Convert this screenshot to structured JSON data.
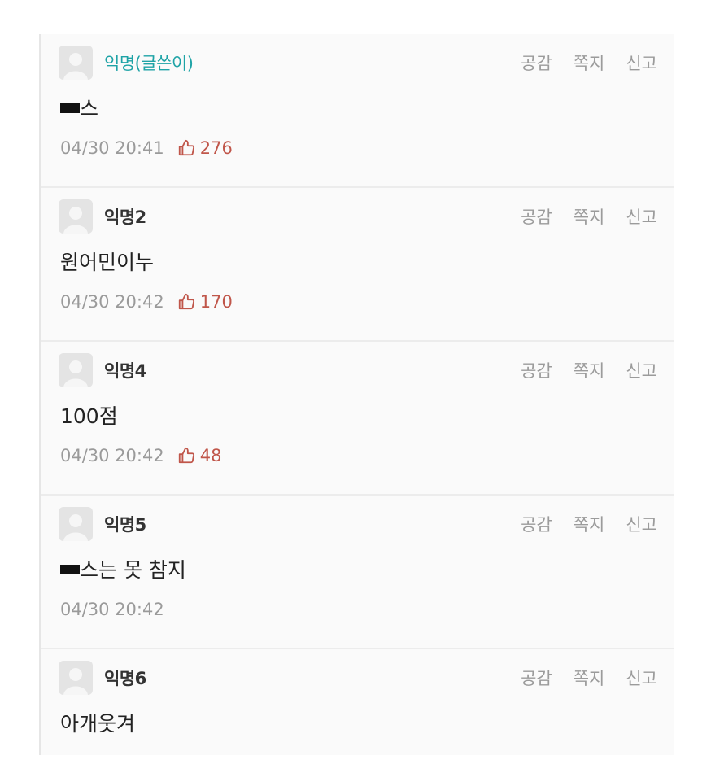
{
  "comments": [
    {
      "author": "익명(글쓴이)",
      "is_op": true,
      "text": "스",
      "redacted_prefix": true,
      "time": "04/30 20:41",
      "likes": "276",
      "actions": [
        "공감",
        "쪽지",
        "신고"
      ]
    },
    {
      "author": "익명2",
      "is_op": false,
      "text": "원어민이누",
      "redacted_prefix": false,
      "time": "04/30 20:42",
      "likes": "170",
      "actions": [
        "공감",
        "쪽지",
        "신고"
      ]
    },
    {
      "author": "익명4",
      "is_op": false,
      "text": "100점",
      "redacted_prefix": false,
      "time": "04/30 20:42",
      "likes": "48",
      "actions": [
        "공감",
        "쪽지",
        "신고"
      ]
    },
    {
      "author": "익명5",
      "is_op": false,
      "text": "스는 못 참지",
      "redacted_prefix": true,
      "time": "04/30 20:42",
      "likes": "",
      "actions": [
        "공감",
        "쪽지",
        "신고"
      ]
    },
    {
      "author": "익명6",
      "is_op": false,
      "text": "아개웃겨",
      "redacted_prefix": false,
      "time": "",
      "likes": "",
      "actions": [
        "공감",
        "쪽지",
        "신고"
      ]
    }
  ],
  "colors": {
    "op_author": "#1ea3a6",
    "like": "#c0564a",
    "muted": "#9a9a9a"
  },
  "icons": {
    "avatar": "default-avatar-icon",
    "like": "thumbs-up-icon"
  }
}
